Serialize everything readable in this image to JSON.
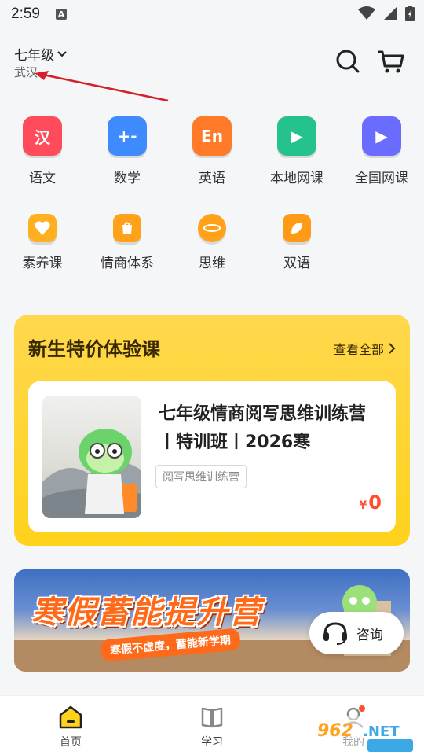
{
  "status_bar": {
    "time": "2:59",
    "a_icon": "A"
  },
  "header": {
    "grade": "七年级",
    "city": "武汉",
    "icons": [
      "search-icon",
      "cart-icon"
    ]
  },
  "subjects_row1": [
    {
      "label": "语文",
      "glyph": "汉",
      "color": "#ff4b5c"
    },
    {
      "label": "数学",
      "glyph": "+-",
      "color": "#3e8bff"
    },
    {
      "label": "英语",
      "glyph": "En",
      "color": "#ff7a29"
    },
    {
      "label": "本地网课",
      "glyph": "▶",
      "color": "#26c28d"
    },
    {
      "label": "全国网课",
      "glyph": "▶",
      "color": "#6a6cff"
    }
  ],
  "subjects_row2": [
    {
      "label": "素养课",
      "icon": "heart-icon",
      "color": "#ffb020"
    },
    {
      "label": "情商体系",
      "icon": "bag-icon",
      "color": "#ffa21a"
    },
    {
      "label": "思维",
      "icon": "planet-icon",
      "color": "#ffa21a"
    },
    {
      "label": "双语",
      "icon": "leaf-icon",
      "color": "#ff9a16"
    }
  ],
  "promo": {
    "title": "新生特价体验课",
    "more": "查看全部",
    "course": {
      "title": "七年级情商阅写思维训练营丨特训班丨2026寒",
      "tag": "阅写思维训练营",
      "currency": "¥",
      "price": "0"
    }
  },
  "banner": {
    "headline": "寒假蓄能提升营",
    "subline": "寒假不虚度，蓄能新学期"
  },
  "consult": {
    "label": "咨询"
  },
  "tabbar": {
    "tabs": [
      {
        "label": "首页",
        "active": true
      },
      {
        "label": "学习",
        "active": false
      },
      {
        "label": "我的",
        "active": false
      }
    ]
  },
  "colors": {
    "accent": "#ffd21c",
    "price": "#ff4d2e",
    "annotation_arrow": "#d4202a"
  }
}
